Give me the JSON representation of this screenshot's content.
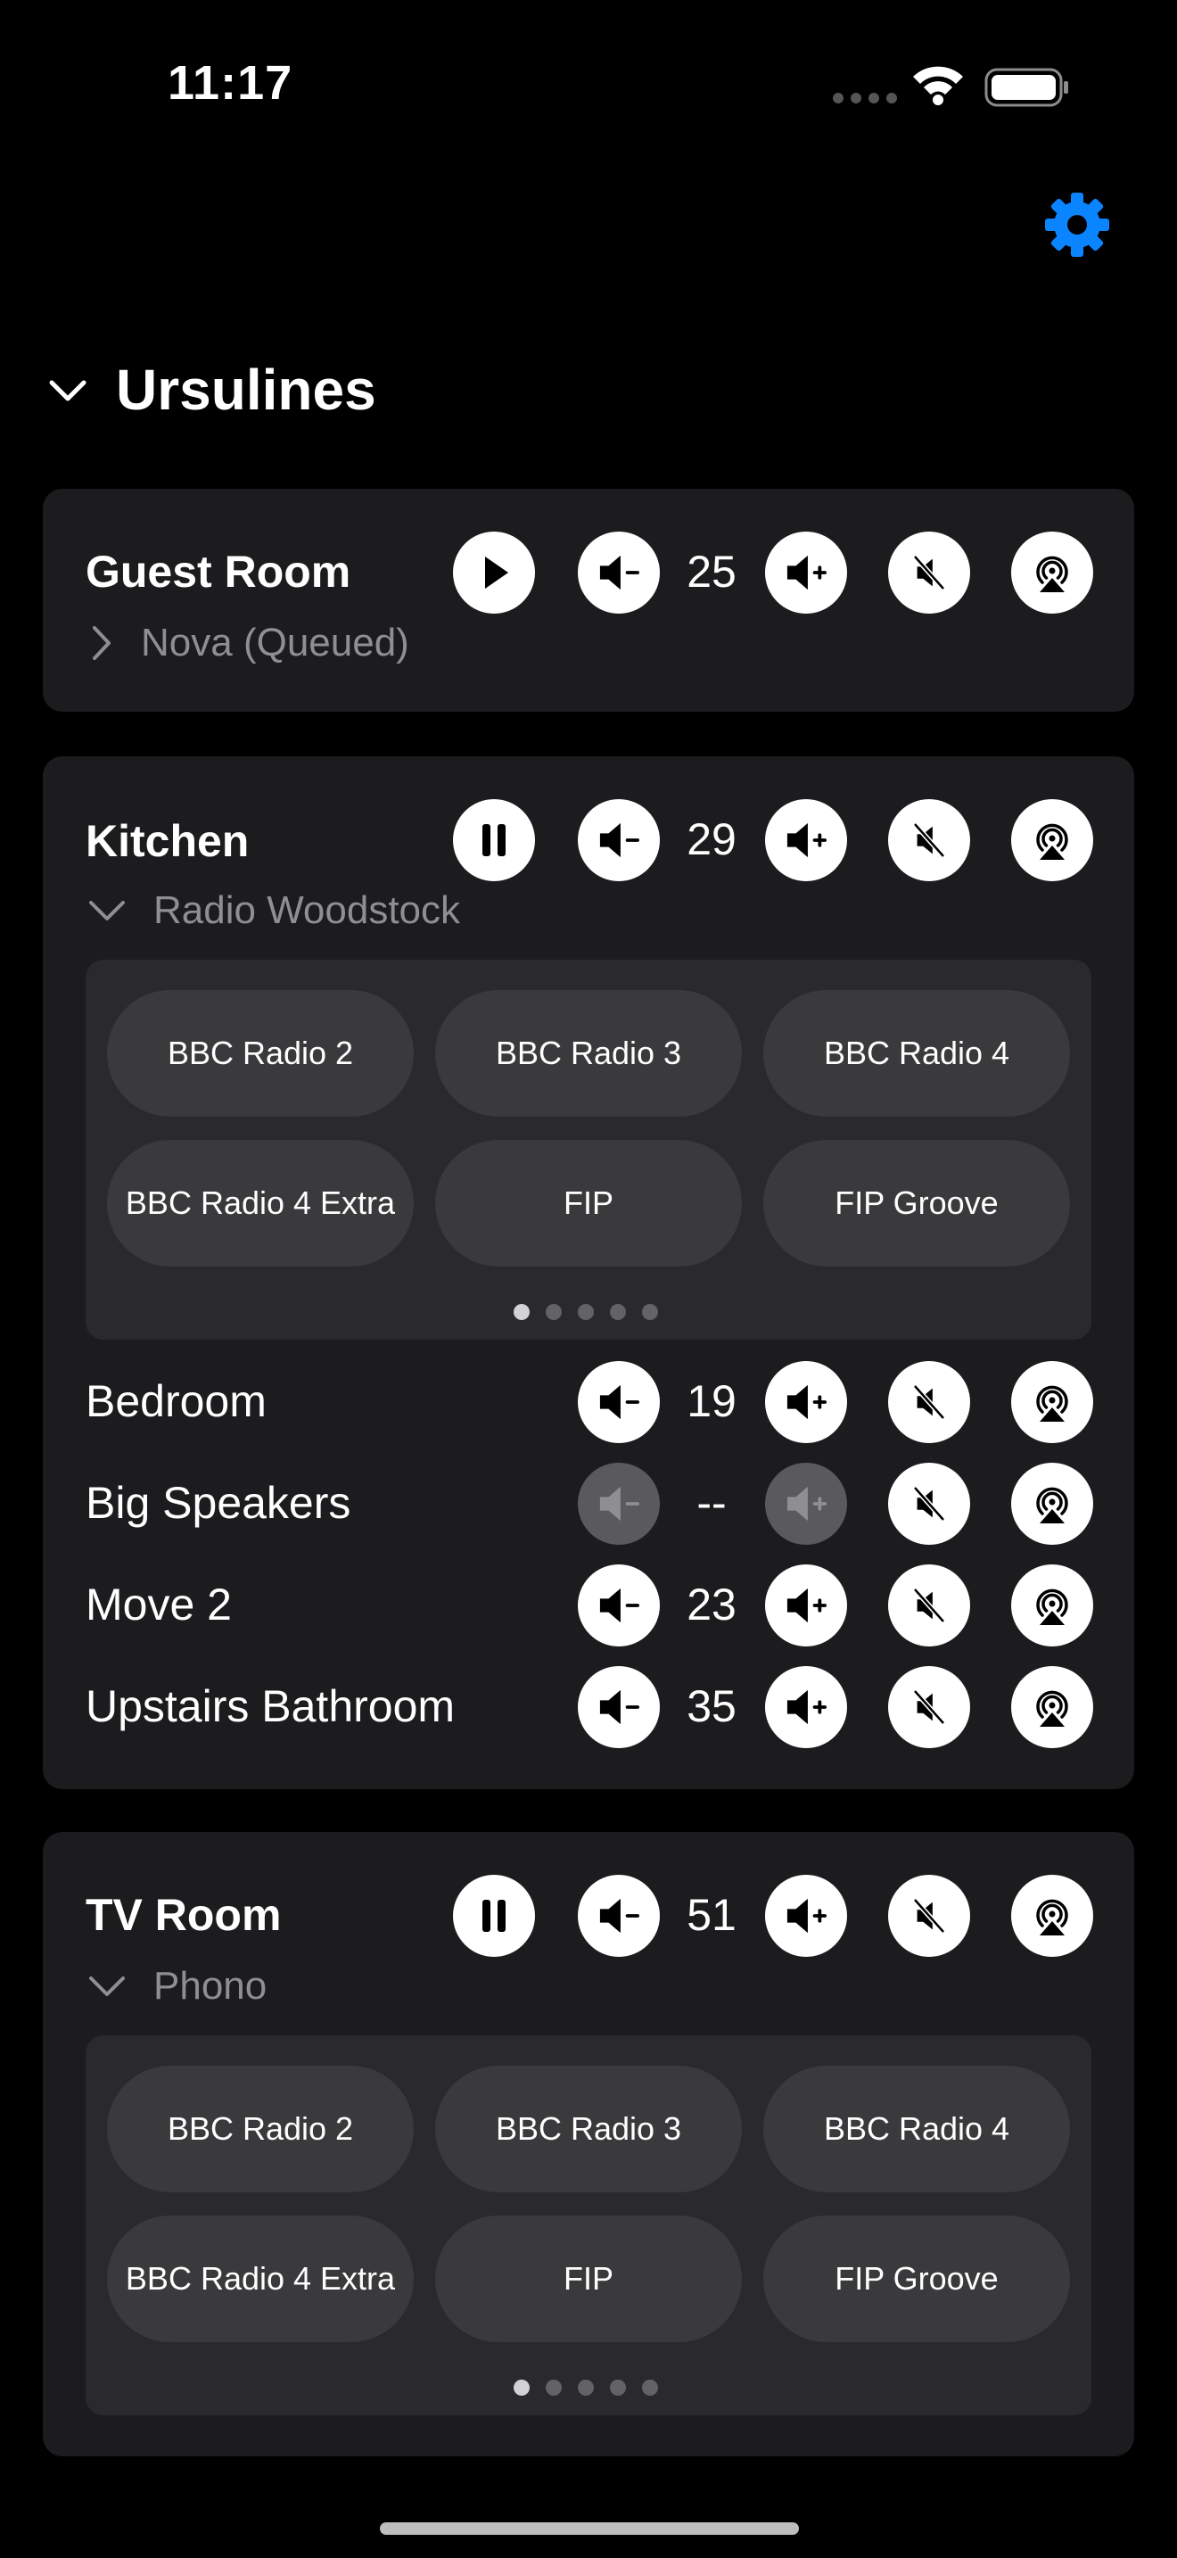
{
  "status_bar": {
    "time": "11:17"
  },
  "home": {
    "name": "Ursulines"
  },
  "icons": {
    "play": "play-icon",
    "pause": "pause-icon",
    "vol_down": "volume-down-icon",
    "vol_up": "volume-up-icon",
    "mute": "mute-icon",
    "airplay": "airplay-icon",
    "settings": "gear-icon"
  },
  "accent_color": "#0a84ff",
  "rooms": [
    {
      "name": "Guest Room",
      "state": "paused",
      "volume": "25",
      "source": "Nova (Queued)",
      "expanded": false
    },
    {
      "name": "Kitchen",
      "state": "playing",
      "volume": "29",
      "source": "Radio Woodstock",
      "expanded": true,
      "presets": [
        "BBC Radio 2",
        "BBC Radio 3",
        "BBC Radio 4",
        "BBC Radio 4 Extra",
        "FIP",
        "FIP Groove"
      ],
      "preset_page": 1,
      "preset_pages": 5,
      "speakers": [
        {
          "name": "Bedroom",
          "volume": "19",
          "enabled": true
        },
        {
          "name": "Big Speakers",
          "volume": "--",
          "enabled": false
        },
        {
          "name": "Move 2",
          "volume": "23",
          "enabled": true
        },
        {
          "name": "Upstairs Bathroom",
          "volume": "35",
          "enabled": true
        }
      ]
    },
    {
      "name": "TV Room",
      "state": "playing",
      "volume": "51",
      "source": "Phono",
      "expanded": true,
      "presets": [
        "BBC Radio 2",
        "BBC Radio 3",
        "BBC Radio 4",
        "BBC Radio 4 Extra",
        "FIP",
        "FIP Groove"
      ],
      "preset_page": 1,
      "preset_pages": 5
    }
  ]
}
